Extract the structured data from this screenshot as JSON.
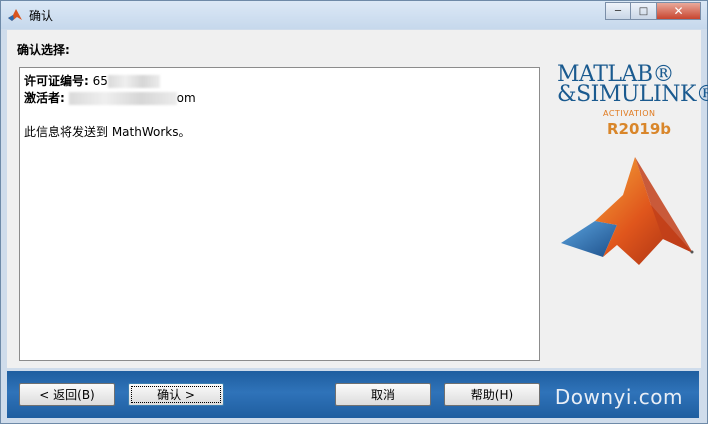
{
  "window": {
    "title": "确认",
    "controls": {
      "minimize": "─",
      "maximize": "□",
      "close": "✕"
    }
  },
  "content": {
    "heading": "确认选择:",
    "license_label": "许可证编号:",
    "license_value": "65",
    "activator_label": "激活者:",
    "activator_suffix": "om",
    "message": "此信息将发送到 MathWorks。"
  },
  "logo": {
    "line1": "MATLAB®",
    "line2": "&SIMULINK®",
    "activation": "ACTIVATION",
    "release": "R2019b",
    "colors": {
      "text": "#1a5a8f",
      "accent": "#e07a1f"
    }
  },
  "buttons": {
    "back": "< 返回(B)",
    "confirm": "确认 >",
    "cancel": "取消",
    "help": "帮助(H)"
  },
  "watermark": "Downyi.com",
  "colors": {
    "bottombar": "#2f73b9",
    "window_frame": "#cfdceb"
  }
}
